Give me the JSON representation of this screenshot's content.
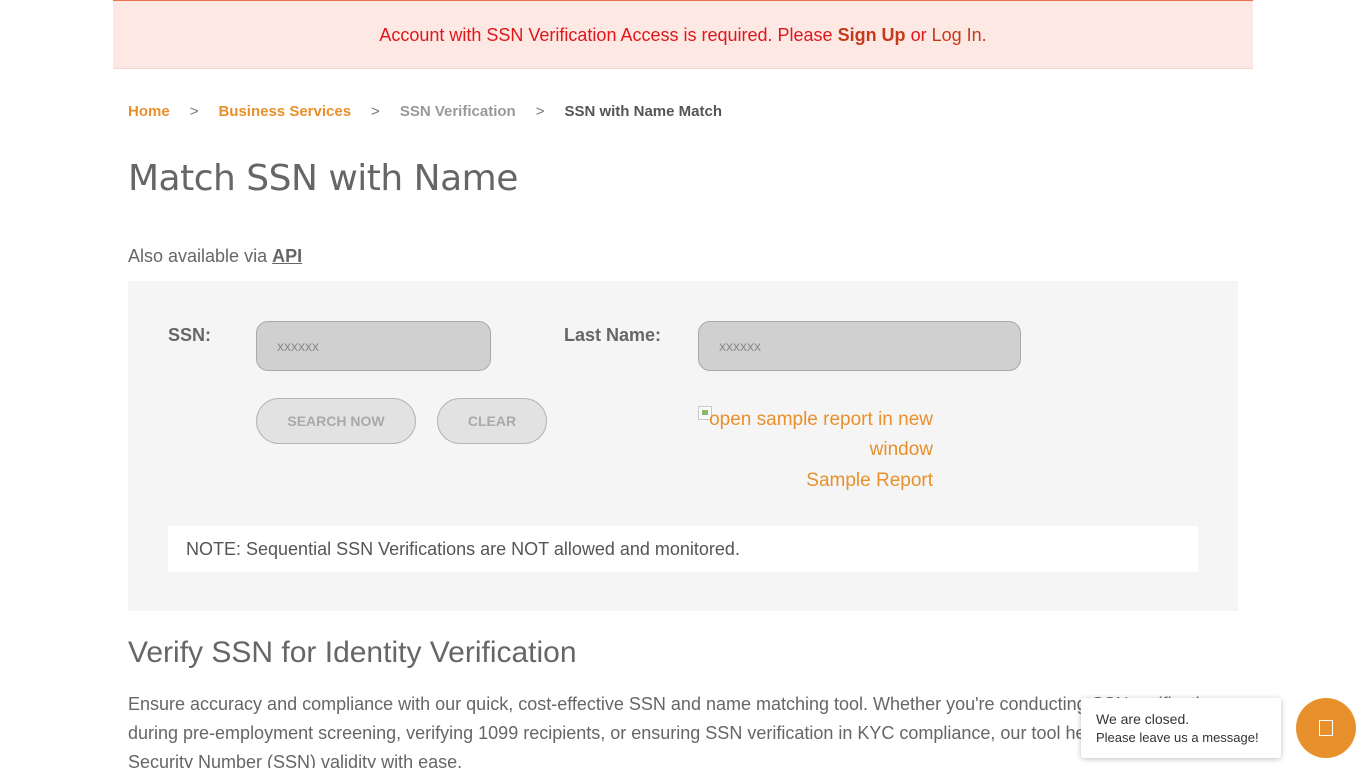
{
  "alert": {
    "prefix": "Account with SSN Verification Access is required. Please ",
    "signup": "Sign Up",
    "middle": " or ",
    "login": "Log In",
    "suffix": "."
  },
  "breadcrumb": {
    "home": "Home",
    "sep": ">",
    "business": "Business Services",
    "ssn_verification": "SSN Verification",
    "current": "SSN with Name Match"
  },
  "page": {
    "title": "Match SSN with Name",
    "api_prefix": "Also available via ",
    "api_link": "API"
  },
  "form": {
    "ssn_label": "SSN:",
    "ssn_placeholder": "xxxxxx",
    "ssn_value": "",
    "last_name_label": "Last Name:",
    "last_name_placeholder": "xxxxxx",
    "last_name_value": "",
    "search_button": "SEARCH NOW",
    "clear_button": "CLEAR",
    "sample_alt": "open sample report in new window",
    "sample_link": "Sample Report",
    "note": "NOTE: Sequential SSN Verifications are NOT allowed and monitored."
  },
  "section": {
    "title": "Verify SSN for Identity Verification",
    "body": "Ensure accuracy and compliance with our quick, cost-effective SSN and name matching tool. Whether you're conducting SSN verification during pre-employment screening, verifying 1099 recipients, or ensuring SSN verification in KYC compliance, our tool helps confirm Social Security Number (SSN) validity with ease."
  },
  "chat": {
    "line1": "We are closed.",
    "line2": "Please leave us a message!",
    "icon": "chat-icon"
  },
  "colors": {
    "accent": "#e8902c",
    "alert_bg": "#fde8e4",
    "alert_text": "#e0161b",
    "panel_bg": "#f5f5f5"
  }
}
